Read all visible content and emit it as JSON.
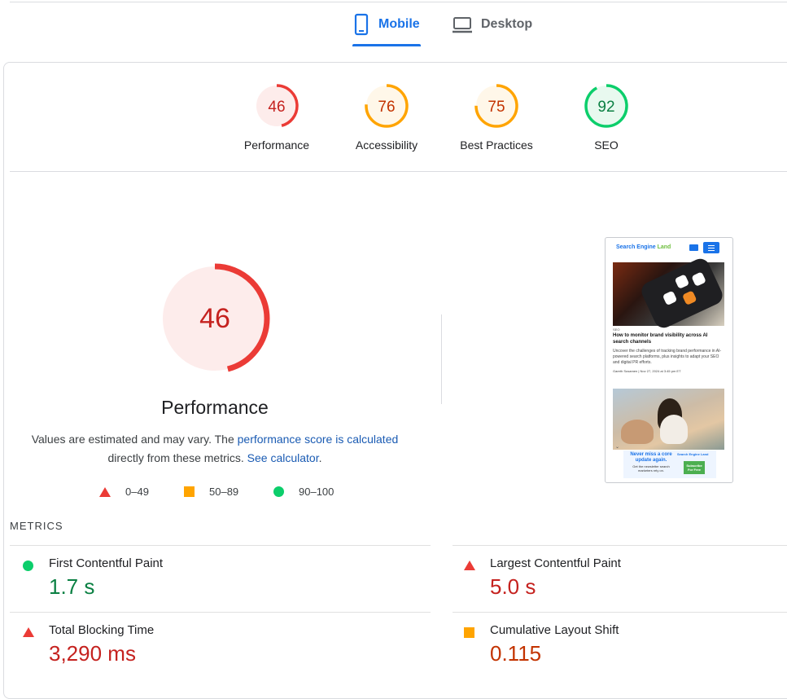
{
  "tabs": [
    {
      "label": "Mobile",
      "active": true,
      "icon": "smartphone-icon"
    },
    {
      "label": "Desktop",
      "active": false,
      "icon": "laptop-icon"
    }
  ],
  "colors": {
    "accent": "#1a73e8",
    "fail": "#eb3b36",
    "average": "#ffa400",
    "pass": "#0cce6b",
    "fail_text": "#c5221f",
    "average_text": "#c33300",
    "pass_text": "#0b8043"
  },
  "categories": [
    {
      "label": "Performance",
      "score": "46",
      "fraction": 0.46,
      "rating": "fail"
    },
    {
      "label": "Accessibility",
      "score": "76",
      "fraction": 0.76,
      "rating": "average"
    },
    {
      "label": "Best Practices",
      "score": "75",
      "fraction": 0.75,
      "rating": "average"
    },
    {
      "label": "SEO",
      "score": "92",
      "fraction": 0.92,
      "rating": "pass"
    }
  ],
  "performance": {
    "score": "46",
    "fraction": 0.46,
    "title": "Performance",
    "desc_prefix": "Values are estimated and may vary. The ",
    "desc_link1": "performance score is calculated",
    "desc_middle": " directly from these metrics. ",
    "desc_link2": "See calculator",
    "desc_suffix": ".",
    "legend": [
      {
        "range": "0–49",
        "shape": "triangle"
      },
      {
        "range": "50–89",
        "shape": "square"
      },
      {
        "range": "90–100",
        "shape": "circle"
      }
    ]
  },
  "screenshot": {
    "logo_part1": "Search Engine ",
    "logo_part2": "Land",
    "tag": "SEO",
    "headline": "How to monitor brand visibility across AI search channels",
    "body": "Uncover the challenges of tracking brand performance in AI-powered search platforms, plus insights to adapt your SEO and digital PR efforts.",
    "meta": "Gareth Susamen | Nov 27, 2024 at 3:45 pm ET",
    "banner_title": "Never miss a core update again.",
    "banner_text": "Get the newsletter search marketers rely on.",
    "banner_logo": "Search Engine Land",
    "banner_button": "Subscribe For Free"
  },
  "metrics_heading": "METRICS",
  "metrics": [
    {
      "name": "First Contentful Paint",
      "value": "1.7 s",
      "rating": "pass"
    },
    {
      "name": "Largest Contentful Paint",
      "value": "5.0 s",
      "rating": "fail"
    },
    {
      "name": "Total Blocking Time",
      "value": "3,290 ms",
      "rating": "fail"
    },
    {
      "name": "Cumulative Layout Shift",
      "value": "0.115",
      "rating": "average"
    }
  ]
}
